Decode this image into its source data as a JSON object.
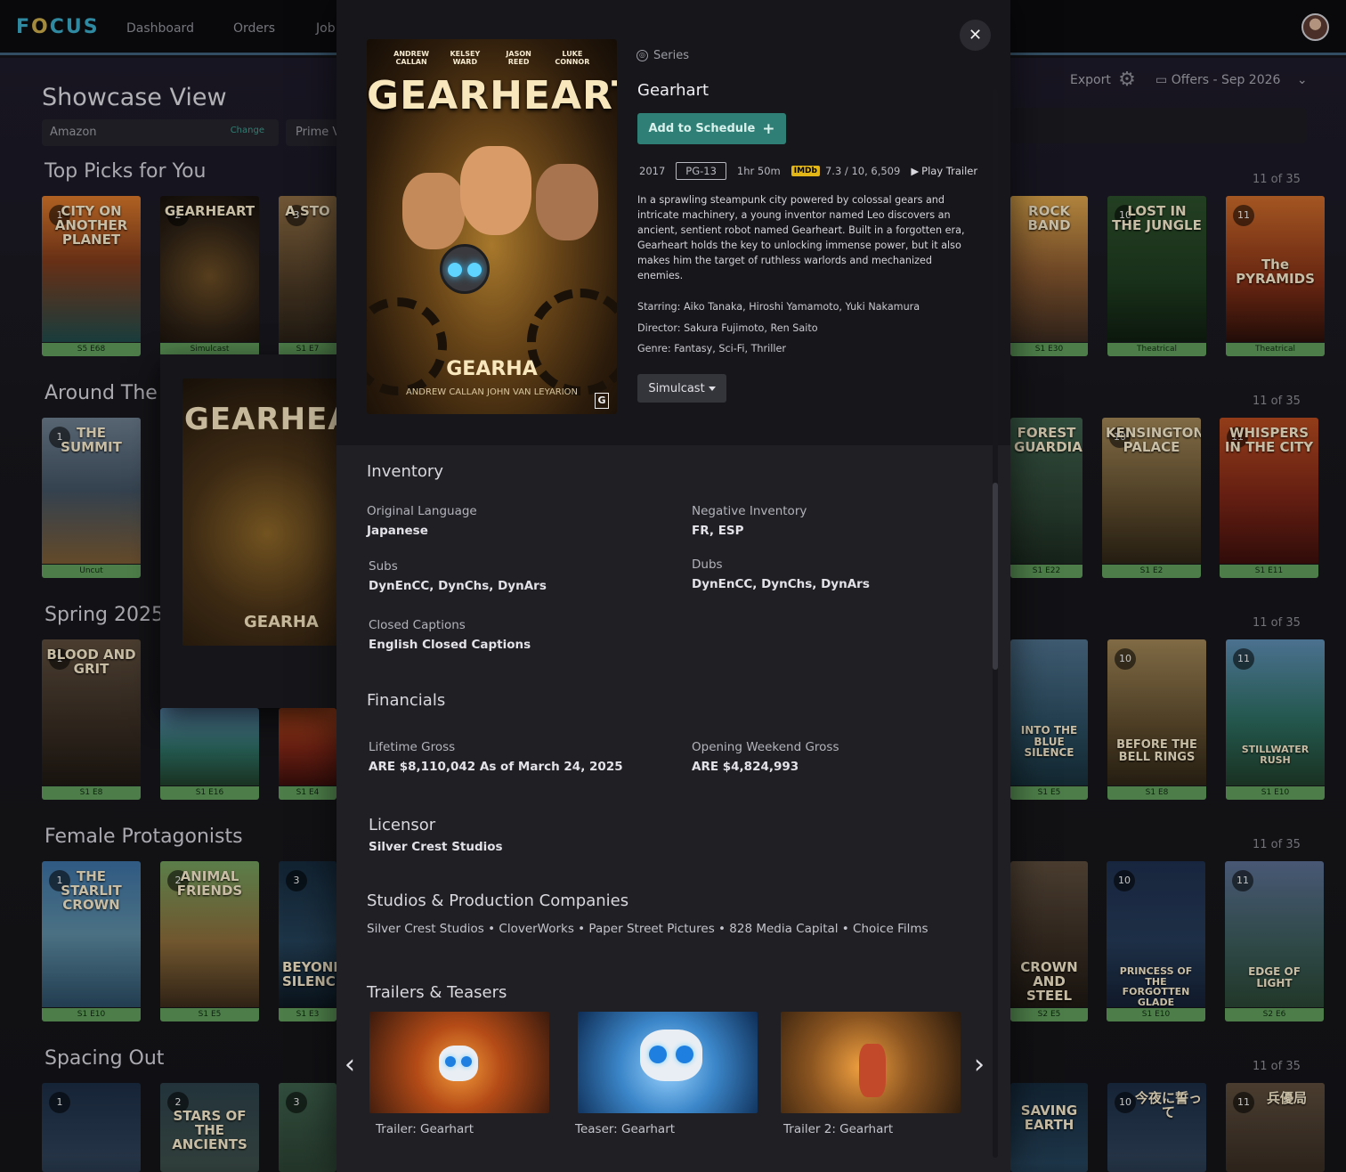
{
  "app": {
    "logo_prefix": "F",
    "logo_o": "O",
    "logo_suffix": "CUS"
  },
  "nav": {
    "items": [
      "Dashboard",
      "Orders",
      "Job"
    ]
  },
  "page": {
    "title": "Showcase View",
    "provider": "Amazon",
    "change_label": "Change",
    "prime_label": "Prime V"
  },
  "toolbar": {
    "export_label": "Export",
    "offers_label": "Offers - Sep 2026"
  },
  "rows": [
    {
      "title": "Top Picks for You",
      "count": "11 of 35"
    },
    {
      "title": "Around The",
      "count": "11 of 35"
    },
    {
      "title": "Spring 2025",
      "count": "11 of 35"
    },
    {
      "title": "Female Protagonists",
      "count": "11 of 35"
    },
    {
      "title": "Spacing Out",
      "count": "11 of 35"
    }
  ],
  "posters": {
    "r1": [
      {
        "rank": "1",
        "title": "CITY ON ANOTHER PLANET",
        "tag": "S5 E68"
      },
      {
        "rank": "2",
        "title": "GEARHEART",
        "tag": "Simulcast"
      },
      {
        "rank": "3",
        "title": "A STO",
        "tag": "S1 E7"
      },
      {
        "rank": "",
        "title": "ROCK BAND",
        "tag": "S1 E30"
      },
      {
        "rank": "10",
        "title": "LOST IN THE JUNGLE",
        "tag": "Theatrical"
      },
      {
        "rank": "11",
        "title": "The PYRAMIDS",
        "tag": "Theatrical"
      }
    ],
    "r2": [
      {
        "rank": "1",
        "title": "THE SUMMIT",
        "tag": "Uncut"
      },
      {
        "rank": "",
        "title": "FOREST GUARDIANS",
        "tag": "S1 E22"
      },
      {
        "rank": "10",
        "title": "KENSINGTON PALACE",
        "tag": "S1 E2"
      },
      {
        "rank": "11",
        "title": "WHISPERS IN THE CITY",
        "tag": "S1 E11"
      }
    ],
    "r3": [
      {
        "rank": "1",
        "title": "BLOOD AND GRIT",
        "tag": "S1 E8"
      },
      {
        "rank": "",
        "title": "",
        "tag": "S1 E16"
      },
      {
        "rank": "",
        "title": "",
        "tag": "S1 E4"
      },
      {
        "rank": "",
        "title": "INTO THE BLUE SILENCE",
        "tag": "S1 E5"
      },
      {
        "rank": "10",
        "title": "BEFORE THE BELL RINGS",
        "tag": "S1 E8"
      },
      {
        "rank": "11",
        "title": "STILLWATER RUSH",
        "tag": "S1 E10"
      }
    ],
    "r4": [
      {
        "rank": "1",
        "title": "THE STARLIT CROWN",
        "tag": "S1 E10"
      },
      {
        "rank": "2",
        "title": "ANIMAL FRIENDS",
        "tag": "S1 E5"
      },
      {
        "rank": "3",
        "title": "BEYOND SILENCE",
        "tag": "S1 E3"
      },
      {
        "rank": "",
        "title": "CROWN AND STEEL",
        "tag": "S2 E5"
      },
      {
        "rank": "10",
        "title": "PRINCESS OF THE FORGOTTEN GLADE",
        "tag": "S1 E10"
      },
      {
        "rank": "11",
        "title": "EDGE OF LIGHT",
        "tag": "S2 E6"
      }
    ],
    "r5": [
      {
        "rank": "1",
        "title": "",
        "tag": ""
      },
      {
        "rank": "2",
        "title": "STARS OF THE ANCIENTS",
        "tag": ""
      },
      {
        "rank": "3",
        "title": "",
        "tag": ""
      },
      {
        "rank": "",
        "title": "SAVING EARTH",
        "tag": ""
      },
      {
        "rank": "10",
        "title": "今夜に誓って",
        "tag": ""
      },
      {
        "rank": "11",
        "title": "兵優局",
        "tag": ""
      }
    ]
  },
  "hover_card": {
    "title": "GEARHEAR",
    "sub": "GEARHA"
  },
  "modal": {
    "key_art": {
      "credits": [
        "ANDREW CALLAN",
        "KELSEY WARD",
        "JASON REED",
        "LUKE CONNOR"
      ],
      "title": "GEARHEART",
      "sub": "GEARHA",
      "sub2": "ANDREW CALLAN   JOHN VAN LEYARION",
      "badge": "G"
    },
    "type": "Series",
    "title": "Gearhart",
    "add_label": "Add to Schedule",
    "year": "2017",
    "rating": "PG-13",
    "runtime": "1hr 50m",
    "imdb_label": "IMDb",
    "imdb_score": "7.3 / 10, 6,509",
    "trailer_label": "Play Trailer",
    "synopsis": "In a sprawling steampunk city powered by colossal gears and intricate machinery, a young inventor named Leo discovers an ancient, sentient robot named Gearheart. Built in a forgotten era, Gearheart holds the key to unlocking immense power, but it also makes him the target of ruthless warlords and mechanized enemies.",
    "starring": "Starring:  Aiko Tanaka, Hiroshi Yamamoto, Yuki Nakamura",
    "director": "Director:  Sakura Fujimoto, Ren Saito",
    "genre": "Genre:  Fantasy, Sci-Fi, Thriller",
    "release_type": "Simulcast",
    "inventory": {
      "title": "Inventory",
      "original_language_label": "Original Language",
      "original_language": "Japanese",
      "negative_label": "Negative Inventory",
      "negative": "FR, ESP",
      "subs_label": "Subs",
      "subs": "DynEnCC, DynChs, DynArs",
      "dubs_label": "Dubs",
      "dubs": "DynEnCC, DynChs, DynArs",
      "cc_label": "Closed Captions",
      "cc": "English Closed Captions"
    },
    "financials": {
      "title": "Financials",
      "lifetime_label": "Lifetime Gross",
      "lifetime": "ARE $8,110,042 As of March 24, 2025",
      "opening_label": "Opening Weekend Gross",
      "opening": "ARE $4,824,993"
    },
    "licensor": {
      "title": "Licensor",
      "value": "Silver Crest Studios"
    },
    "studios": {
      "title": "Studios & Production Companies",
      "value": "Silver Crest Studios • CloverWorks • Paper Street Pictures • 828 Media Capital • Choice Films"
    },
    "trailers": {
      "title": "Trailers & Teasers",
      "items": [
        "Trailer: Gearhart",
        "Teaser: Gearhart",
        "Trailer 2: Gearhart"
      ]
    }
  }
}
